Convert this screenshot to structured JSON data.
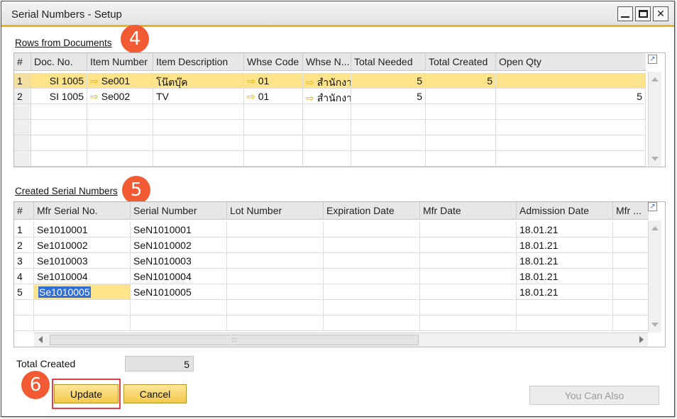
{
  "window": {
    "title": "Serial Numbers - Setup"
  },
  "rows_section": {
    "title": "Rows from Documents",
    "callout": "4",
    "columns": [
      "#",
      "Doc. No.",
      "Item Number",
      "Item Description",
      "Whse Code",
      "Whse N...",
      "Total Needed",
      "Total Created",
      "Open Qty"
    ],
    "rows": [
      {
        "n": "1",
        "doc_no": "SI 1005",
        "item_number": "Se001",
        "item_description": "โน๊ตบุ๊ค",
        "whse_code": "01",
        "whse_name": "สำนักงา",
        "total_needed": "5",
        "total_created": "5",
        "open_qty": ""
      },
      {
        "n": "2",
        "doc_no": "SI 1005",
        "item_number": "Se002",
        "item_description": "TV",
        "whse_code": "01",
        "whse_name": "สำนักงา",
        "total_needed": "5",
        "total_created": "",
        "open_qty": "5"
      }
    ]
  },
  "serials_section": {
    "title": "Created Serial Numbers",
    "callout": "5",
    "columns": [
      "#",
      "Mfr Serial No.",
      "Serial Number",
      "Lot Number",
      "Expiration Date",
      "Mfr Date",
      "Admission Date",
      "Mfr ..."
    ],
    "rows": [
      {
        "n": "1",
        "mfr_serial": "Se1010001",
        "serial": "SeN1010001",
        "lot": "",
        "exp": "",
        "mfr_date": "",
        "admission": "18.01.21"
      },
      {
        "n": "2",
        "mfr_serial": "Se1010002",
        "serial": "SeN1010002",
        "lot": "",
        "exp": "",
        "mfr_date": "",
        "admission": "18.01.21"
      },
      {
        "n": "3",
        "mfr_serial": "Se1010003",
        "serial": "SeN1010003",
        "lot": "",
        "exp": "",
        "mfr_date": "",
        "admission": "18.01.21"
      },
      {
        "n": "4",
        "mfr_serial": "Se1010004",
        "serial": "SeN1010004",
        "lot": "",
        "exp": "",
        "mfr_date": "",
        "admission": "18.01.21"
      },
      {
        "n": "5",
        "mfr_serial": "Se1010005",
        "serial": "SeN1010005",
        "lot": "",
        "exp": "",
        "mfr_date": "",
        "admission": "18.01.21"
      }
    ]
  },
  "footer": {
    "total_created_label": "Total Created",
    "total_created_value": "5",
    "callout": "6",
    "update_label": "Update",
    "cancel_label": "Cancel",
    "you_can_also_label": "You Can Also"
  },
  "colors": {
    "accent": "#f0b11c",
    "selected_row": "#fde48a",
    "callout": "#f15a33",
    "highlight_frame": "#e0404a"
  },
  "icons": [
    "close-icon",
    "minimize-icon",
    "maximize-icon",
    "link-arrow-icon",
    "expand-icon"
  ]
}
